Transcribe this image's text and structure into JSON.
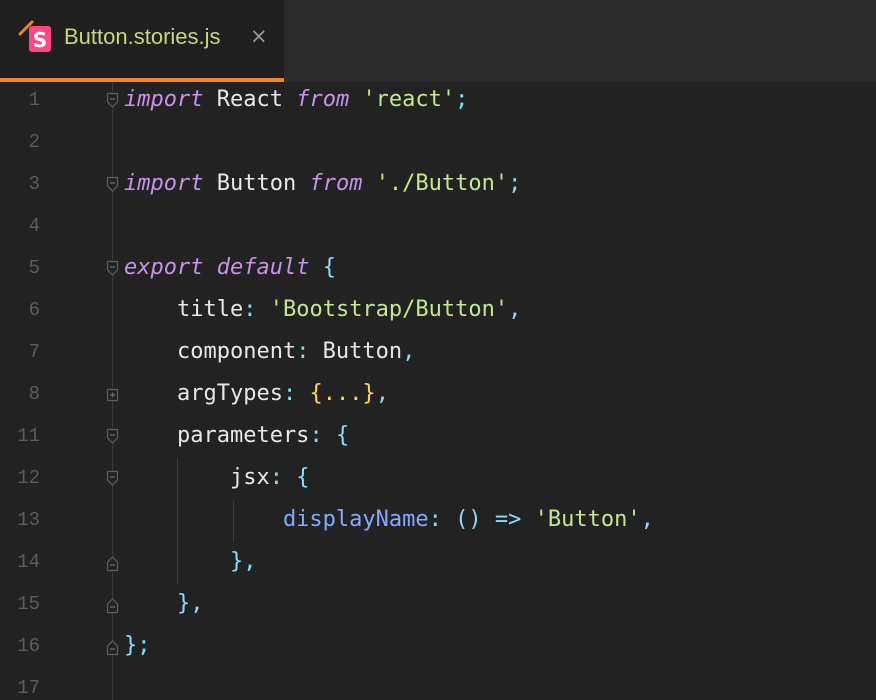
{
  "tab": {
    "title": "Button.stories.js",
    "close": "×",
    "icon": "storybook-icon"
  },
  "lines": [
    {
      "num": "1",
      "tokens": [
        {
          "t": "import",
          "c": "kw"
        },
        {
          "t": " React ",
          "c": "id"
        },
        {
          "t": "from",
          "c": "kw"
        },
        {
          "t": " ",
          "c": "id"
        },
        {
          "t": "'react'",
          "c": "str"
        },
        {
          "t": ";",
          "c": "punc"
        }
      ],
      "fold": "open"
    },
    {
      "num": "2",
      "tokens": [],
      "fold": ""
    },
    {
      "num": "3",
      "tokens": [
        {
          "t": "import",
          "c": "kw"
        },
        {
          "t": " Button ",
          "c": "id"
        },
        {
          "t": "from",
          "c": "kw"
        },
        {
          "t": " ",
          "c": "id"
        },
        {
          "t": "'./Button'",
          "c": "str"
        },
        {
          "t": ";",
          "c": "punc"
        }
      ],
      "fold": "open"
    },
    {
      "num": "4",
      "tokens": [],
      "fold": ""
    },
    {
      "num": "5",
      "tokens": [
        {
          "t": "export",
          "c": "kw"
        },
        {
          "t": " ",
          "c": "id"
        },
        {
          "t": "default",
          "c": "kw"
        },
        {
          "t": " ",
          "c": "id"
        },
        {
          "t": "{",
          "c": "brace"
        }
      ],
      "fold": "open"
    },
    {
      "num": "6",
      "tokens": [
        {
          "t": "    title",
          "c": "prop"
        },
        {
          "t": ":",
          "c": "punc"
        },
        {
          "t": " ",
          "c": "id"
        },
        {
          "t": "'Bootstrap/Button'",
          "c": "str"
        },
        {
          "t": ",",
          "c": "punc"
        }
      ],
      "fold": ""
    },
    {
      "num": "7",
      "tokens": [
        {
          "t": "    component",
          "c": "prop"
        },
        {
          "t": ":",
          "c": "punc"
        },
        {
          "t": " Button",
          "c": "id"
        },
        {
          "t": ",",
          "c": "punc"
        }
      ],
      "fold": ""
    },
    {
      "num": "8",
      "tokens": [
        {
          "t": "    argTypes",
          "c": "prop"
        },
        {
          "t": ":",
          "c": "punc"
        },
        {
          "t": " ",
          "c": "id"
        },
        {
          "t": "{...}",
          "c": "fold-brace"
        },
        {
          "t": ",",
          "c": "punc"
        }
      ],
      "fold": "collapsed"
    },
    {
      "num": "11",
      "tokens": [
        {
          "t": "    parameters",
          "c": "prop"
        },
        {
          "t": ":",
          "c": "punc"
        },
        {
          "t": " ",
          "c": "id"
        },
        {
          "t": "{",
          "c": "brace"
        }
      ],
      "fold": "open"
    },
    {
      "num": "12",
      "tokens": [
        {
          "t": "        jsx",
          "c": "prop"
        },
        {
          "t": ":",
          "c": "punc"
        },
        {
          "t": " ",
          "c": "id"
        },
        {
          "t": "{",
          "c": "brace"
        }
      ],
      "fold": "open"
    },
    {
      "num": "13",
      "tokens": [
        {
          "t": "            displayName",
          "c": "prop-blue"
        },
        {
          "t": ":",
          "c": "punc"
        },
        {
          "t": " ",
          "c": "id"
        },
        {
          "t": "()",
          "c": "punc"
        },
        {
          "t": " ",
          "c": "id"
        },
        {
          "t": "=>",
          "c": "punc"
        },
        {
          "t": " ",
          "c": "id"
        },
        {
          "t": "'Button'",
          "c": "str"
        },
        {
          "t": ",",
          "c": "punc"
        }
      ],
      "fold": ""
    },
    {
      "num": "14",
      "tokens": [
        {
          "t": "        }",
          "c": "brace"
        },
        {
          "t": ",",
          "c": "punc"
        }
      ],
      "fold": "close"
    },
    {
      "num": "15",
      "tokens": [
        {
          "t": "    }",
          "c": "brace"
        },
        {
          "t": ",",
          "c": "punc"
        }
      ],
      "fold": "close"
    },
    {
      "num": "16",
      "tokens": [
        {
          "t": "}",
          "c": "brace"
        },
        {
          "t": ";",
          "c": "punc"
        }
      ],
      "fold": "close"
    },
    {
      "num": "17",
      "tokens": [],
      "fold": ""
    }
  ]
}
